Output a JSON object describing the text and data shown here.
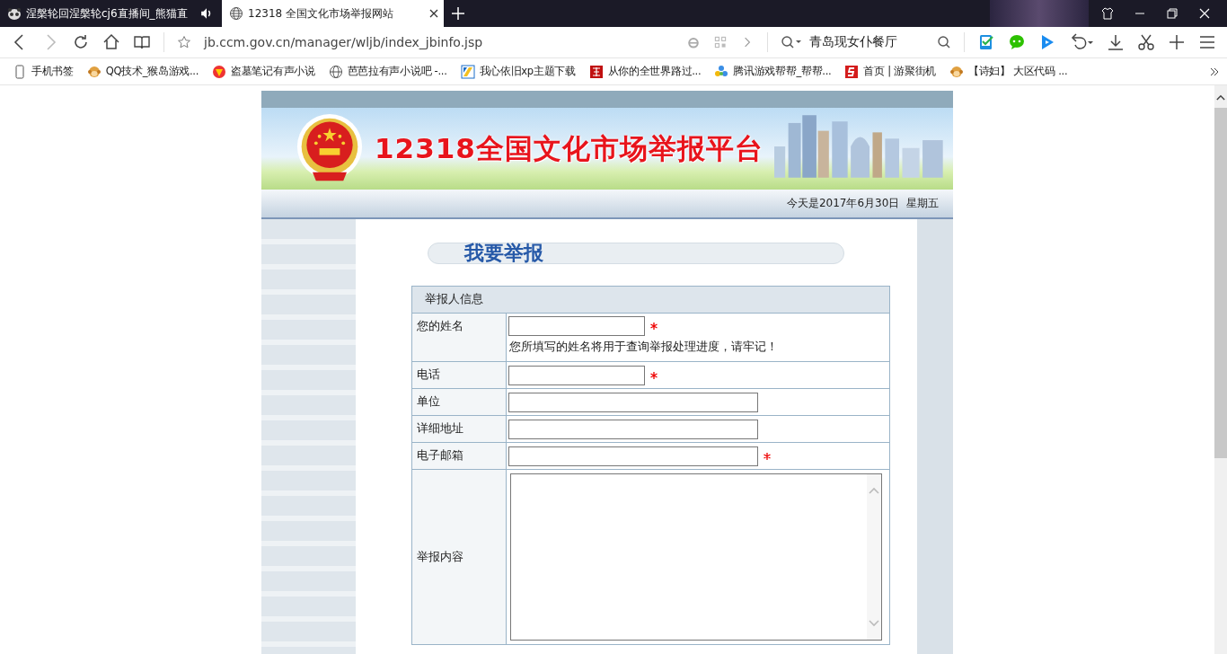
{
  "browser": {
    "tabs": [
      {
        "title": "涅槃轮回涅槃轮cj6直播间_熊猫直",
        "selected": false,
        "audio": true
      },
      {
        "title": "12318 全国文化市场举报网站",
        "selected": true,
        "audio": false
      }
    ],
    "url": "jb.ccm.gov.cn/manager/wljb/index_jbinfo.jsp",
    "search": {
      "value": "青岛现女仆餐厅"
    },
    "bookmarks": [
      {
        "label": "手机书签",
        "kind": "phone"
      },
      {
        "label": "QQ技术_猴岛游戏...",
        "kind": "monkey"
      },
      {
        "label": "盗墓笔记有声小说",
        "kind": "red-circle"
      },
      {
        "label": "芭芭拉有声小说吧 -...",
        "kind": "globe"
      },
      {
        "label": "我心依旧xp主题下载",
        "kind": "xp"
      },
      {
        "label": "从你的全世界路过...",
        "kind": "red-square"
      },
      {
        "label": "腾讯游戏帮帮_帮帮...",
        "kind": "tencent"
      },
      {
        "label": "首页 | 游聚街机",
        "kind": "red-s"
      },
      {
        "label": "【诗妇】 大区代码 ...",
        "kind": "monkey"
      }
    ]
  },
  "page": {
    "banner_title": "12318全国文化市场举报平台",
    "date": "今天是2017年6月30日  星期五",
    "heading": "我要举报",
    "form": {
      "section": "举报人信息",
      "rows": [
        {
          "label": "您的姓名",
          "kind": "short",
          "required": true,
          "note": "您所填写的姓名将用于查询举报处理进度，请牢记！"
        },
        {
          "label": "电话",
          "kind": "short",
          "required": true
        },
        {
          "label": "单位",
          "kind": "long",
          "required": false
        },
        {
          "label": "详细地址",
          "kind": "long",
          "required": false
        },
        {
          "label": "电子邮箱",
          "kind": "long",
          "required": true
        },
        {
          "label": "举报内容",
          "kind": "textarea",
          "required": false
        }
      ]
    }
  }
}
